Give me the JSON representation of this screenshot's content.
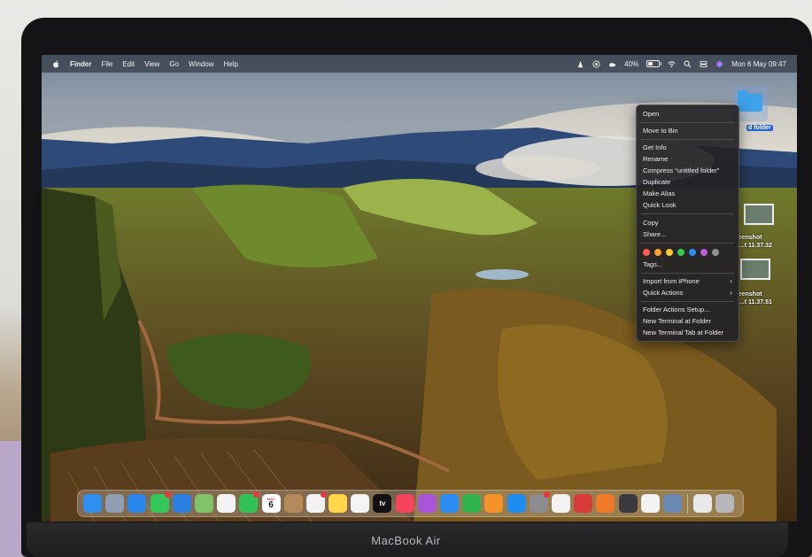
{
  "menubar": {
    "app_name": "Finder",
    "menus": [
      "File",
      "Edit",
      "View",
      "Go",
      "Window",
      "Help"
    ],
    "battery_percent": "40%",
    "battery_level": 0.4,
    "datetime": "Mon 6 May  09:47"
  },
  "desktop": {
    "folder_label": "d folder",
    "screenshots": [
      {
        "line1": "reenshot",
        "line2": "0...t 11.37.32"
      },
      {
        "line1": "reenshot",
        "line2": "0...t 11.37.51"
      }
    ]
  },
  "context_menu": {
    "open": "Open",
    "move_to_bin": "Move to Bin",
    "get_info": "Get Info",
    "rename": "Rename",
    "compress": "Compress “untitled folder”",
    "duplicate": "Duplicate",
    "make_alias": "Make Alias",
    "quick_look": "Quick Look",
    "copy": "Copy",
    "share": "Share...",
    "tag_colors": [
      "#ff5c51",
      "#ff9f2e",
      "#f7c531",
      "#2fcc53",
      "#2f8cf5",
      "#bf5ae0",
      "#8e8e93"
    ],
    "tags": "Tags...",
    "import_from_iphone": "Import from iPhone",
    "quick_actions": "Quick Actions",
    "folder_actions_setup": "Folder Actions Setup...",
    "new_terminal": "New Terminal at Folder",
    "new_terminal_tab": "New Terminal Tab at Folder"
  },
  "dock": {
    "calendar_month": "MAY",
    "calendar_day": "6",
    "tv_label": "tv",
    "apps": [
      {
        "name": "finder-icon",
        "color": "#2f8ff0"
      },
      {
        "name": "launchpad-icon",
        "color": "#8f9eb3"
      },
      {
        "name": "safari-icon",
        "color": "#2a86e8"
      },
      {
        "name": "messages-icon",
        "color": "#34c759",
        "badge": true
      },
      {
        "name": "mail-icon",
        "color": "#2a7fe0"
      },
      {
        "name": "maps-icon",
        "color": "#7fc36a"
      },
      {
        "name": "photos-icon",
        "color": "#f3f3f3"
      },
      {
        "name": "facetime-icon",
        "color": "#30c255",
        "badge": true
      },
      {
        "name": "calendar-icon",
        "color": "#ffffff"
      },
      {
        "name": "contacts-icon",
        "color": "#b48a5a"
      },
      {
        "name": "reminders-icon",
        "color": "#f2f2f2",
        "badge": true
      },
      {
        "name": "notes-icon",
        "color": "#ffd54a"
      },
      {
        "name": "freeform-icon",
        "color": "#f4f4f4"
      },
      {
        "name": "apple-tv-icon",
        "color": "#111111"
      },
      {
        "name": "music-icon",
        "color": "#f5455c"
      },
      {
        "name": "podcasts-icon",
        "color": "#a855d8"
      },
      {
        "name": "keynote-icon",
        "color": "#2c8cf2"
      },
      {
        "name": "numbers-icon",
        "color": "#2fb34a"
      },
      {
        "name": "pages-icon",
        "color": "#f5922a"
      },
      {
        "name": "app-store-icon",
        "color": "#1e8cf0"
      },
      {
        "name": "system-settings-icon",
        "color": "#8c8c90",
        "badge": true
      },
      {
        "name": "chrome-icon",
        "color": "#f2f2f2"
      },
      {
        "name": "antivirus-icon",
        "color": "#d93a3a"
      },
      {
        "name": "firefox-icon",
        "color": "#f07a2a"
      },
      {
        "name": "claquette-icon",
        "color": "#3a3a3e"
      },
      {
        "name": "vlc-icon",
        "color": "#f3f3f3"
      },
      {
        "name": "preview-icon",
        "color": "#6a89b5"
      }
    ],
    "docs": [
      {
        "name": "document-stack-icon",
        "color": "#e8e8e8"
      },
      {
        "name": "bin-icon",
        "color": "#b8b8bc"
      }
    ]
  },
  "hardware": {
    "brand": "MacBook Air"
  }
}
